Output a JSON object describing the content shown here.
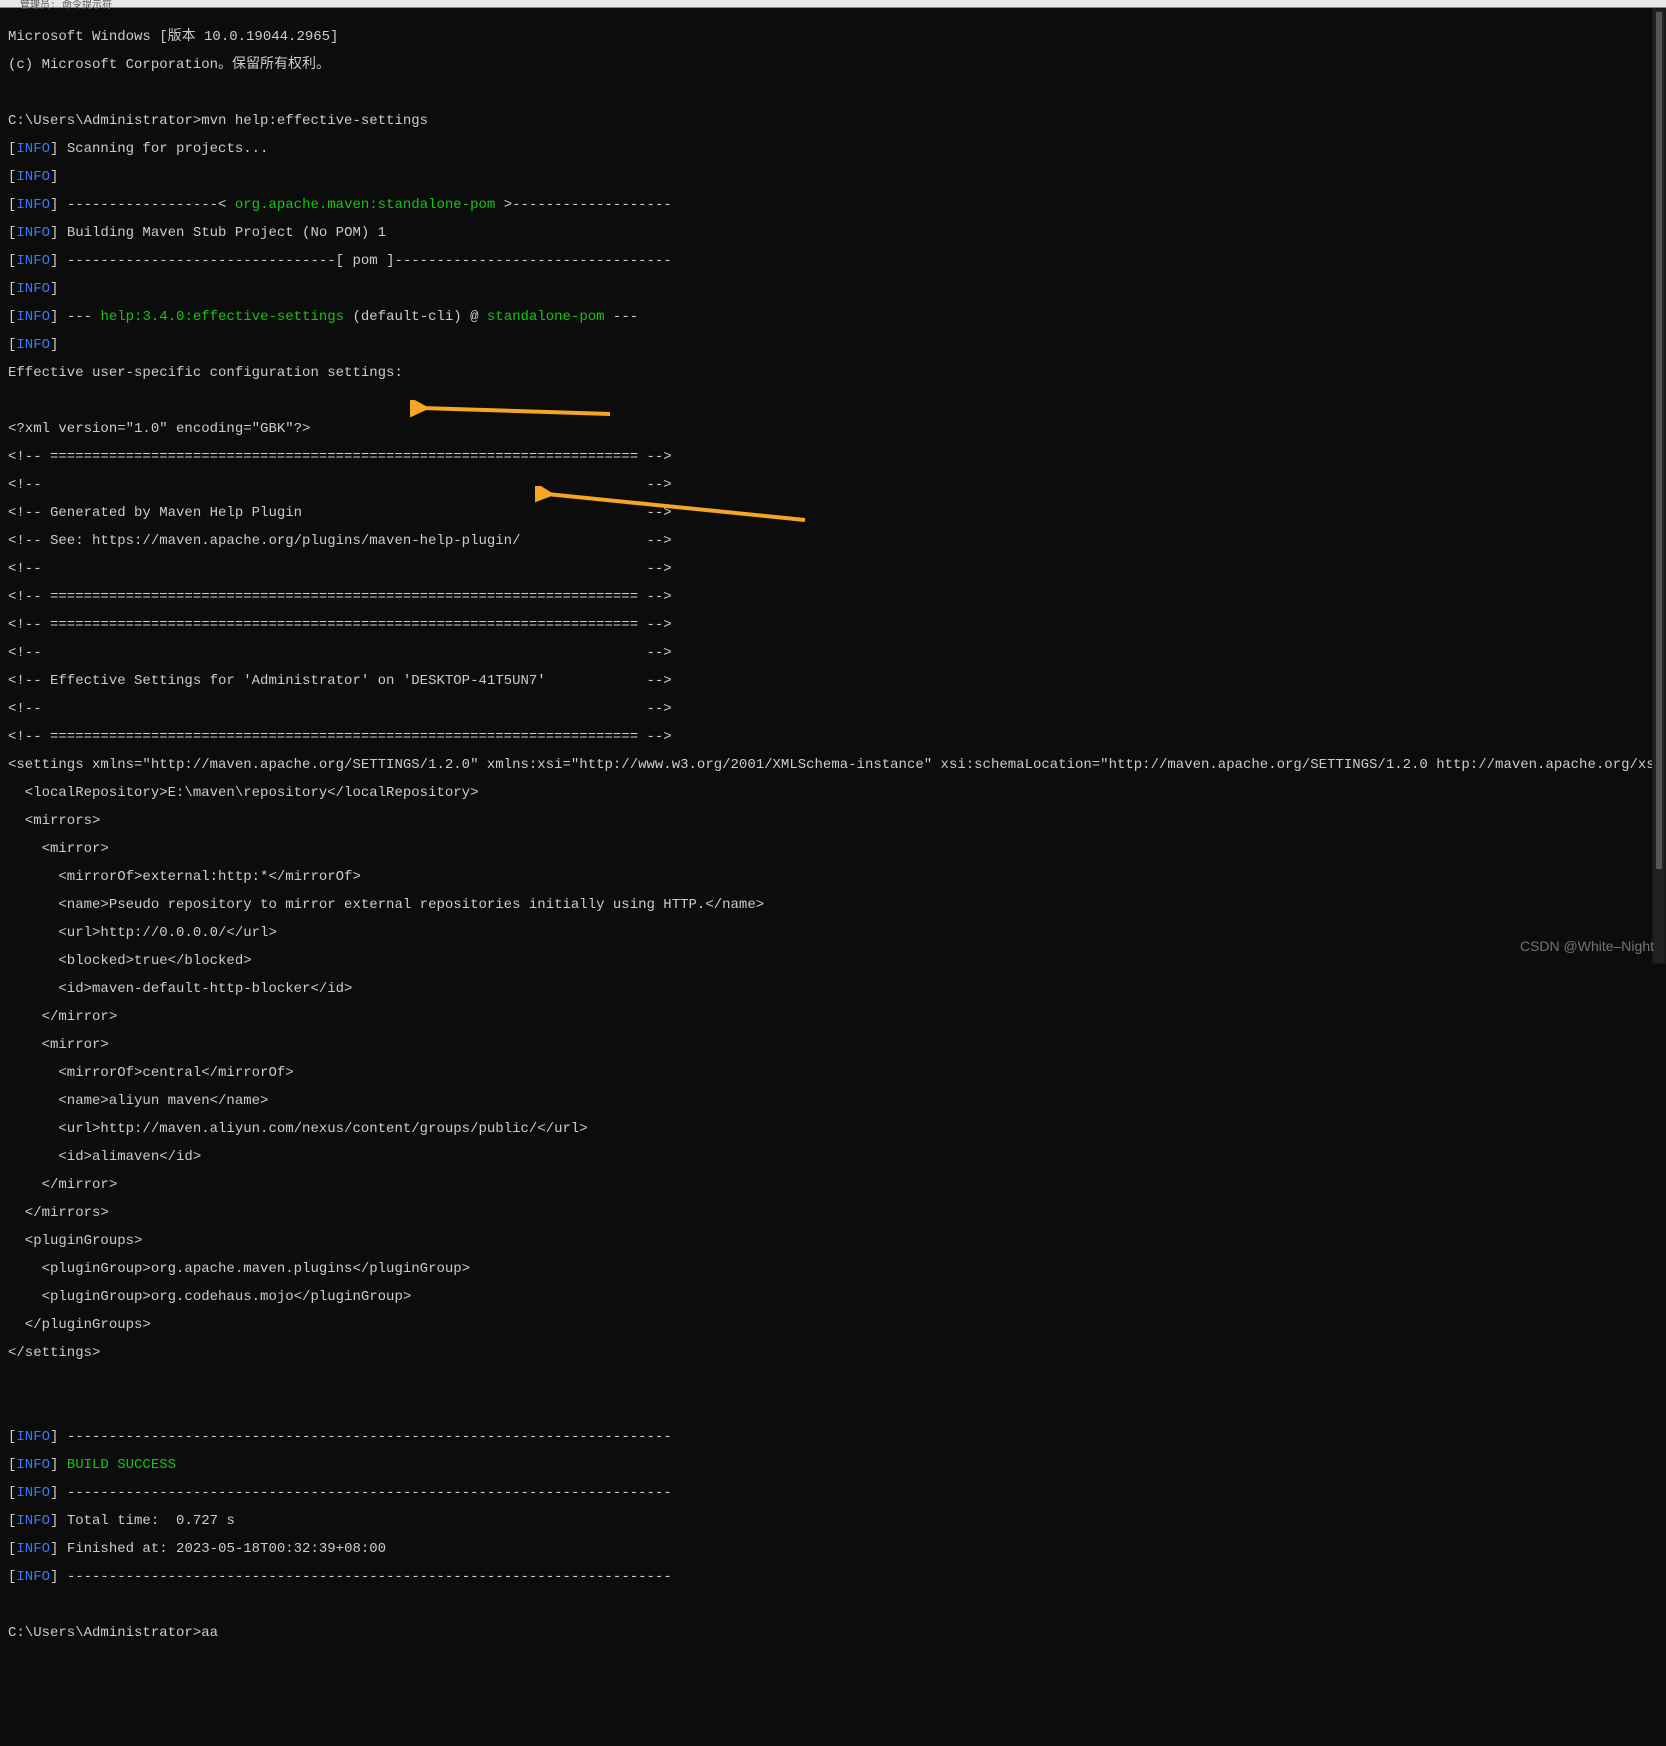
{
  "window": {
    "title": "管理员: 命令提示符"
  },
  "header": {
    "line1": "Microsoft Windows [版本 10.0.19044.2965]",
    "line2": "(c) Microsoft Corporation。保留所有权利。"
  },
  "prompt1": "C:\\Users\\Administrator>mvn help:effective-settings",
  "info_label": "INFO",
  "scan": " Scanning for projects...",
  "dash_open": " ------------------< ",
  "standalone": "org.apache.maven:standalone-pom",
  "dash_close": " >-------------------",
  "building": " Building Maven Stub Project (No POM) 1",
  "pom_line": " --------------------------------[ pom ]---------------------------------",
  "goal_prefix": " --- ",
  "goal_text": "help:3.4.0:effective-settings",
  "goal_mid": " (default-cli) @ ",
  "standalone_short": "standalone-pom",
  "goal_suffix": " ---",
  "effective_header": "Effective user-specific configuration settings:",
  "xml_decl": "<?xml version=\"1.0\" encoding=\"GBK\"?>",
  "sep_long": "<!-- ====================================================================== -->",
  "blank_comment": "<!--                                                                        -->",
  "gen_by": "<!-- Generated by Maven Help Plugin                                         -->",
  "see_url": "<!-- See: https://maven.apache.org/plugins/maven-help-plugin/               -->",
  "eff_for": "<!-- Effective Settings for 'Administrator' on 'DESKTOP-41T5UN7'            -->",
  "settings_open": "<settings xmlns=\"http://maven.apache.org/SETTINGS/1.2.0\" xmlns:xsi=\"http://www.w3.org/2001/XMLSchema-instance\" xsi:schemaLocation=\"http://maven.apache.org/SETTINGS/1.2.0 http://maven.apache.org/xsd/settings-",
  "local_repo": "  <localRepository>E:\\maven\\repository</localRepository>",
  "mirrors_open": "  <mirrors>",
  "mirror_open": "    <mirror>",
  "m1_of": "      <mirrorOf>external:http:*</mirrorOf>",
  "m1_name": "      <name>Pseudo repository to mirror external repositories initially using HTTP.</name>",
  "m1_url": "      <url>http://0.0.0.0/</url>",
  "m1_blocked": "      <blocked>true</blocked>",
  "m1_id": "      <id>maven-default-http-blocker</id>",
  "mirror_close": "    </mirror>",
  "m2_of": "      <mirrorOf>central</mirrorOf>",
  "m2_name": "      <name>aliyun maven</name>",
  "m2_url": "      <url>http://maven.aliyun.com/nexus/content/groups/public/</url>",
  "m2_id": "      <id>alimaven</id>",
  "mirrors_close": "  </mirrors>",
  "pg_open": "  <pluginGroups>",
  "pg1": "    <pluginGroup>org.apache.maven.plugins</pluginGroup>",
  "pg2": "    <pluginGroup>org.codehaus.mojo</pluginGroup>",
  "pg_close": "  </pluginGroups>",
  "settings_close": "</settings>",
  "dash72": " ------------------------------------------------------------------------",
  "build_success": " BUILD SUCCESS",
  "total_time": " Total time:  0.727 s",
  "finished_at": " Finished at: 2023-05-18T00:32:39+08:00",
  "prompt2": "C:\\Users\\Administrator>aa",
  "watermark": "CSDN @White–Night"
}
